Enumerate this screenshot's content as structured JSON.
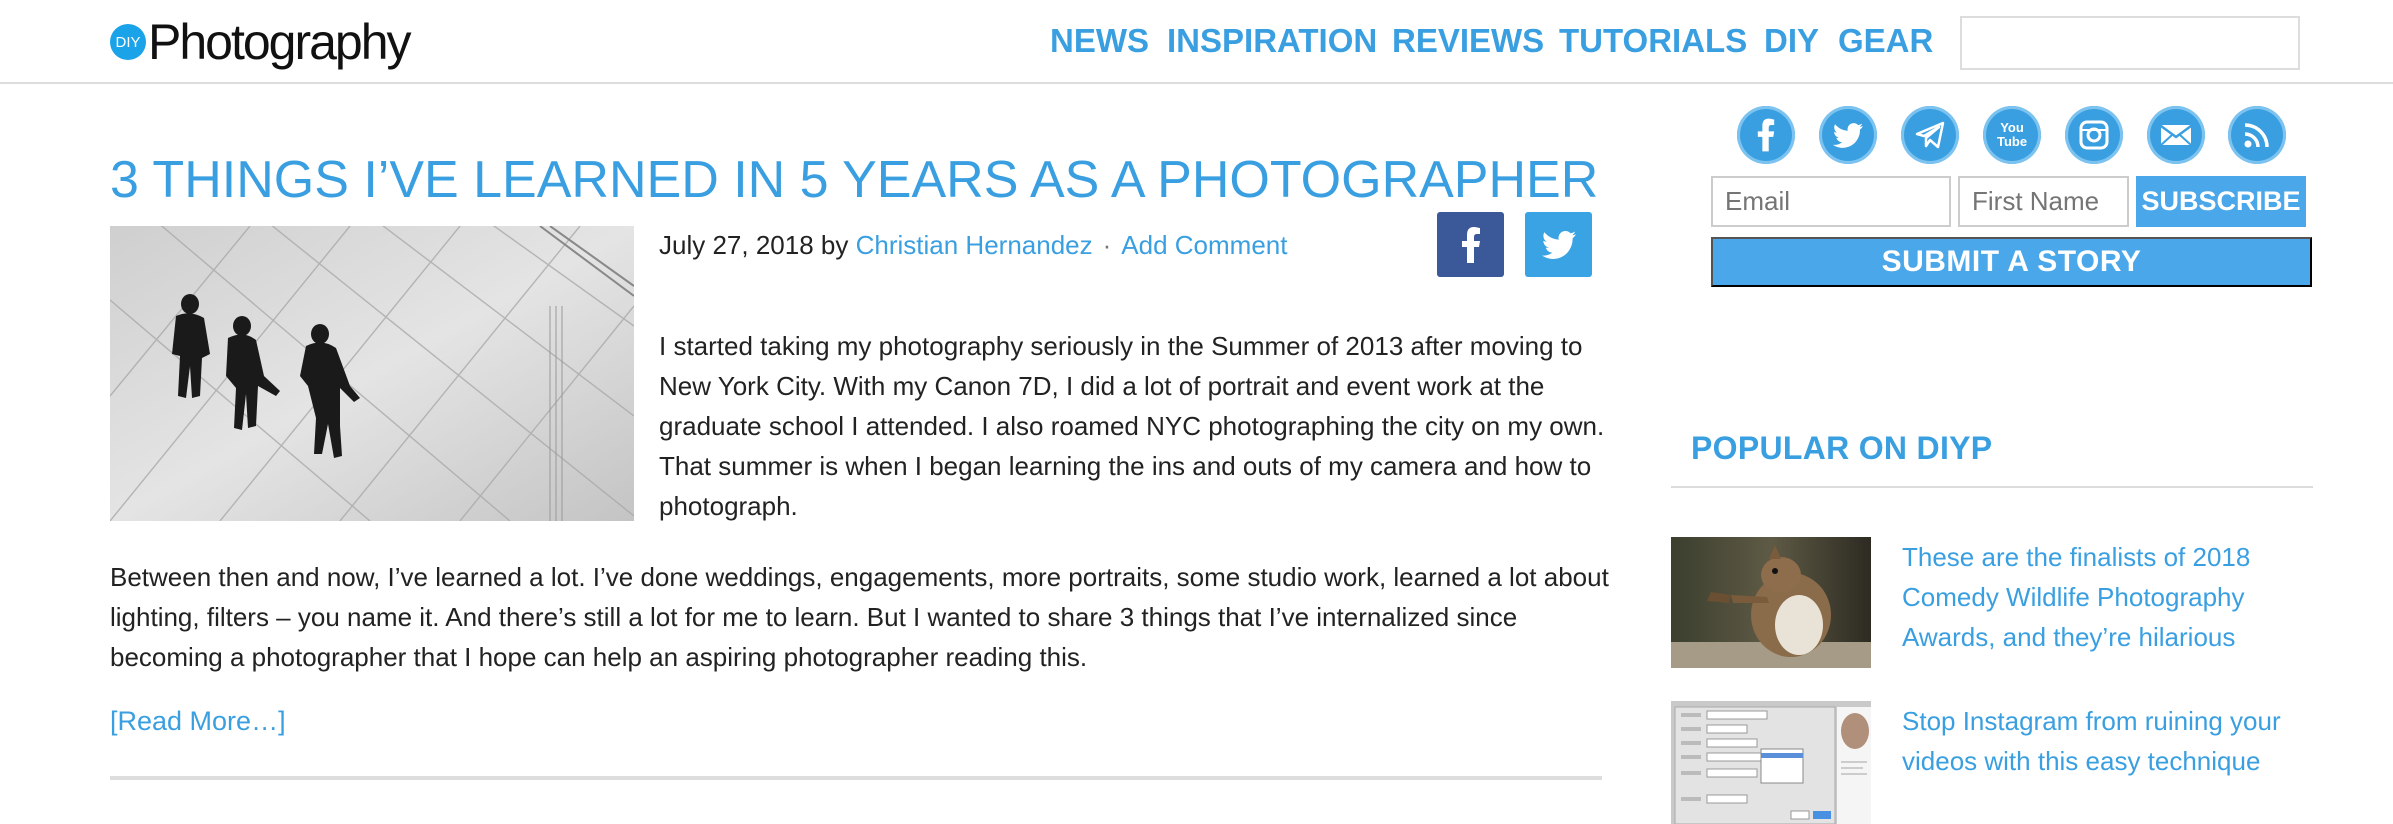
{
  "header": {
    "logo_badge": "DIY",
    "logo_text": "Photography",
    "nav": [
      "NEWS",
      "INSPIRATION",
      "REVIEWS",
      "TUTORIALS",
      "DIY",
      "GEAR"
    ],
    "search_placeholder": ""
  },
  "article": {
    "title": "3 THINGS I’VE LEARNED IN 5 YEARS AS A PHOTOGRAPHER",
    "date": "July 27, 2018",
    "by": "by",
    "author": "Christian Hernandez",
    "separator": "·",
    "comment_link": "Add Comment",
    "paragraph1": "I started taking my photography seriously in the Summer of 2013 after moving to New York City. With my Canon 7D, I did a lot of portrait and event work at the graduate school I attended. I also roamed NYC photographing the city on my own. That summer is when I began learning the ins and outs of my camera and how to photograph.",
    "paragraph2": "Between then and now, I’ve learned a lot. I’ve done weddings, engagements, more portraits, some studio work, learned a lot about lighting, filters – you name it. And there’s still a lot for me to learn. But I wanted to share 3 things that I’ve internalized since becoming a photographer that I hope can help an aspiring photographer reading this.",
    "read_more": "[Read More…]"
  },
  "sidebar": {
    "social_icons": [
      "facebook-icon",
      "twitter-icon",
      "telegram-icon",
      "youtube-icon",
      "instagram-icon",
      "email-icon",
      "rss-icon"
    ],
    "youtube_text": "You Tube",
    "email_placeholder": "Email",
    "firstname_placeholder": "First Name",
    "subscribe_label": "SUBSCRIBE",
    "submit_story_label": "SUBMIT A STORY",
    "popular_title": "POPULAR ON DIYP",
    "popular_items": [
      {
        "title": "These are the finalists of 2018 Comedy Wildlife Photography Awards, and they’re hilarious"
      },
      {
        "title": "Stop Instagram from ruining your videos with this easy technique"
      }
    ]
  },
  "colors": {
    "accent": "#3a9fe0",
    "button": "#4aa7ea",
    "facebook": "#3b5998",
    "twitter": "#3aa3e3"
  }
}
